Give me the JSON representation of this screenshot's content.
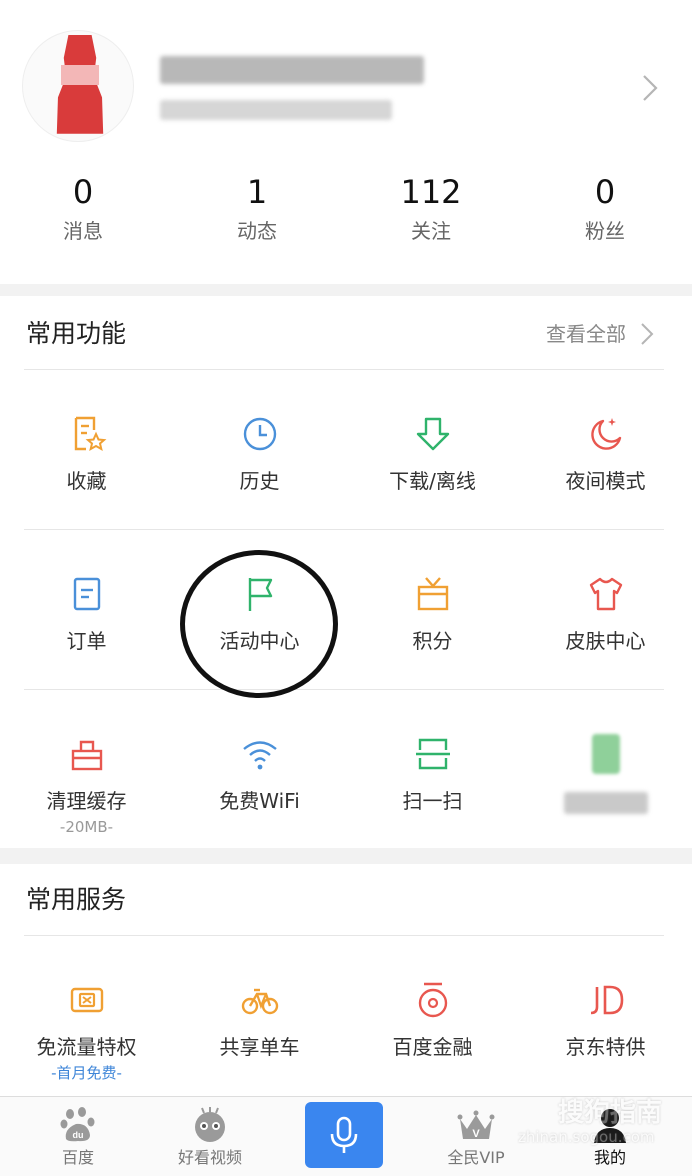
{
  "profile": {
    "stats": [
      {
        "value": "0",
        "label": "消息"
      },
      {
        "value": "1",
        "label": "动态"
      },
      {
        "value": "112",
        "label": "关注"
      },
      {
        "value": "0",
        "label": "粉丝"
      }
    ]
  },
  "functions": {
    "title": "常用功能",
    "more": "查看全部",
    "items": [
      {
        "label": "收藏",
        "icon": "favorites-icon",
        "color": "#f0a033"
      },
      {
        "label": "历史",
        "icon": "history-clock-icon",
        "color": "#4a90d9"
      },
      {
        "label": "下载/离线",
        "icon": "download-icon",
        "color": "#2fb36b"
      },
      {
        "label": "夜间模式",
        "icon": "night-mode-icon",
        "color": "#e8574f"
      },
      {
        "label": "订单",
        "icon": "order-icon",
        "color": "#4a90d9"
      },
      {
        "label": "活动中心",
        "icon": "flag-icon",
        "color": "#2fb36b"
      },
      {
        "label": "积分",
        "icon": "gift-box-icon",
        "color": "#f0a033"
      },
      {
        "label": "皮肤中心",
        "icon": "shirt-icon",
        "color": "#e8574f"
      },
      {
        "label": "清理缓存",
        "note": "-20MB-",
        "icon": "clean-cache-icon",
        "color": "#e8574f"
      },
      {
        "label": "免费WiFi",
        "icon": "wifi-icon",
        "color": "#4a90d9"
      },
      {
        "label": "扫一扫",
        "icon": "scan-icon",
        "color": "#2fb36b"
      }
    ]
  },
  "services": {
    "title": "常用服务",
    "items": [
      {
        "label": "免流量特权",
        "note": "-首月免费-",
        "icon": "data-card-icon",
        "color": "#f0a033"
      },
      {
        "label": "共享单车",
        "icon": "bicycle-icon",
        "color": "#f0a033"
      },
      {
        "label": "百度金融",
        "icon": "coin-icon",
        "color": "#e8574f"
      },
      {
        "label": "京东特供",
        "icon": "jd-logo-icon",
        "color": "#e8574f"
      }
    ]
  },
  "tabbar": {
    "tabs": [
      {
        "label": "百度",
        "icon": "baidu-paw-icon"
      },
      {
        "label": "好看视频",
        "icon": "haokan-video-icon"
      },
      {
        "label": "",
        "icon": "microphone-icon"
      },
      {
        "label": "全民VIP",
        "icon": "crown-icon"
      },
      {
        "label": "我的",
        "icon": "user-icon"
      }
    ],
    "accent": "#3a86ef"
  },
  "watermark": {
    "main": "搜狗指南",
    "sub": "zhinan.sogou.com"
  }
}
